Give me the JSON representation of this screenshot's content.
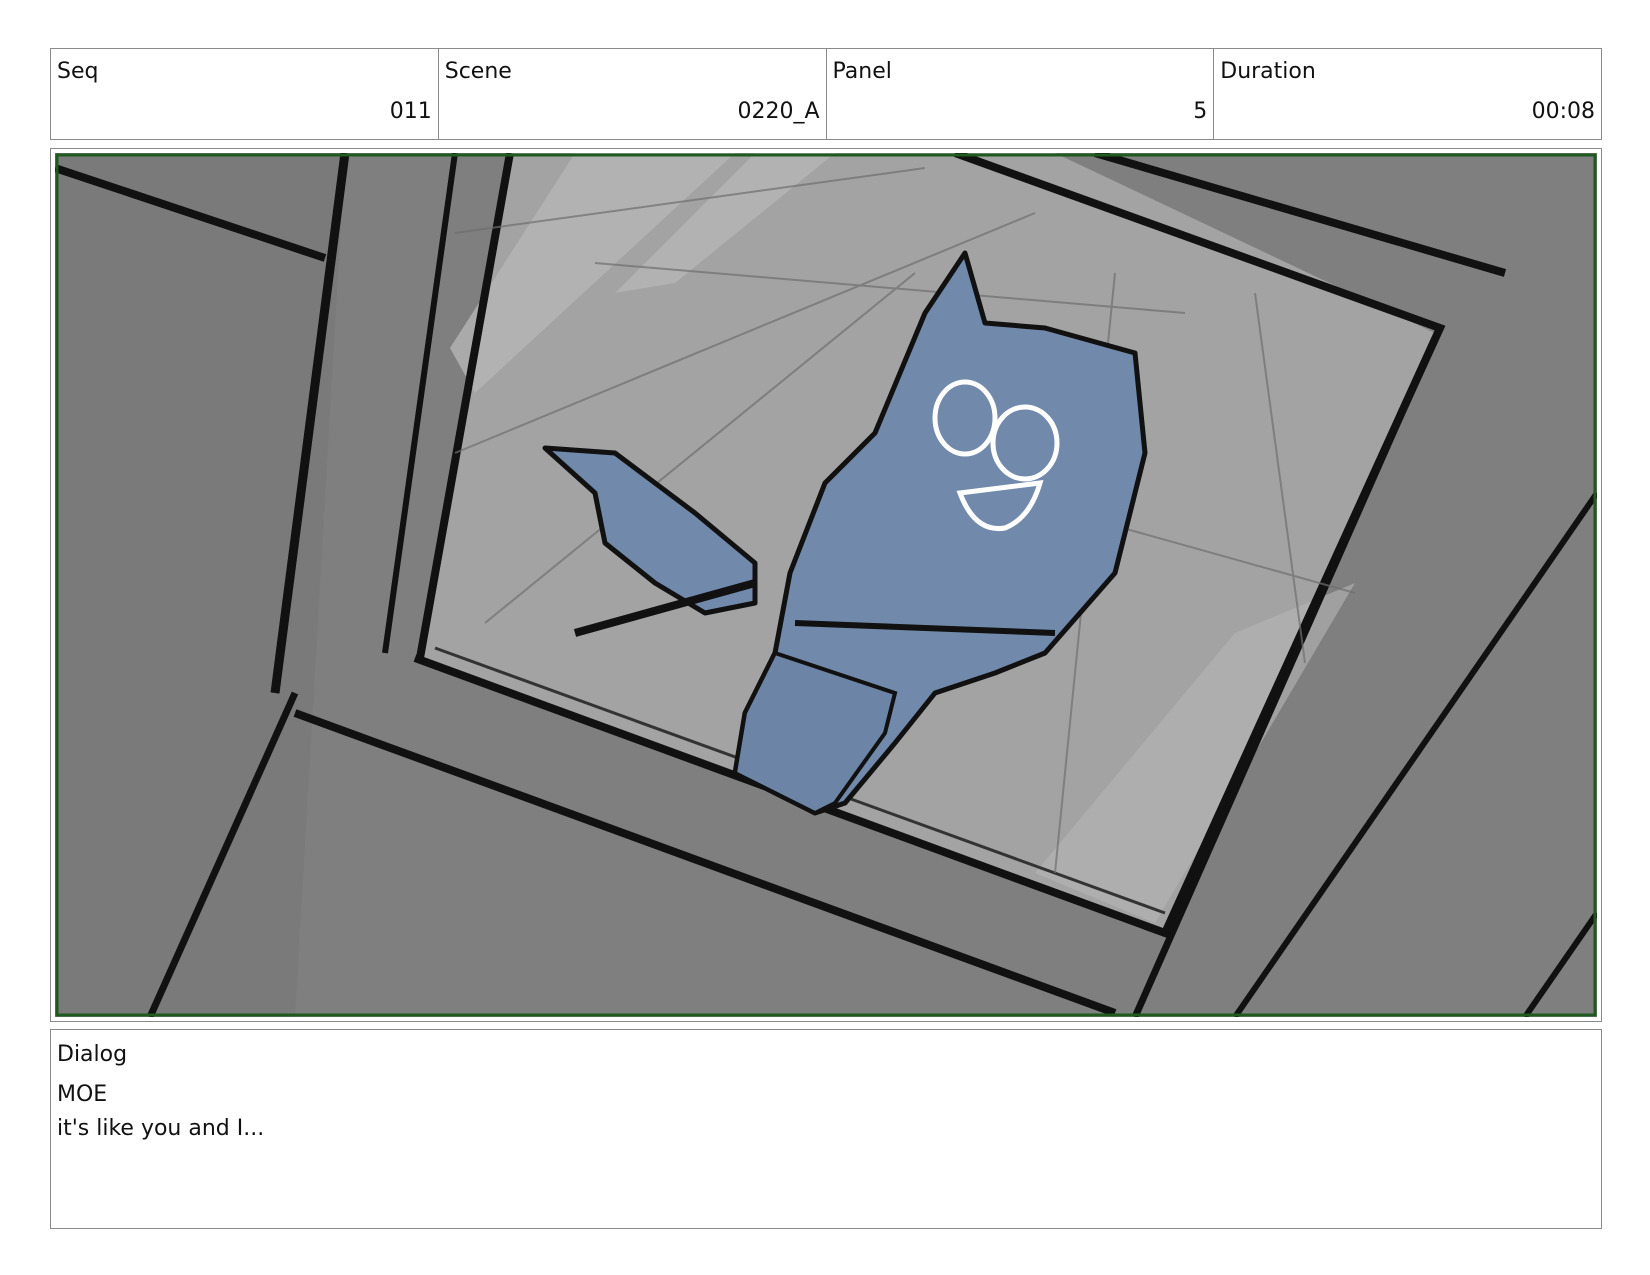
{
  "header": {
    "seq": {
      "label": "Seq",
      "value": "011"
    },
    "scene": {
      "label": "Scene",
      "value": "0220_A"
    },
    "panel": {
      "label": "Panel",
      "value": "5"
    },
    "duration": {
      "label": "Duration",
      "value": "00:08"
    }
  },
  "dialog": {
    "label": "Dialog",
    "speaker": "MOE",
    "line": "it's like you and I..."
  },
  "colors": {
    "panel_border": "#1f5a1f",
    "background_gray": "#7f7f7f",
    "glass_gray": "#a3a3a3",
    "character_blue": "#7189ab"
  }
}
